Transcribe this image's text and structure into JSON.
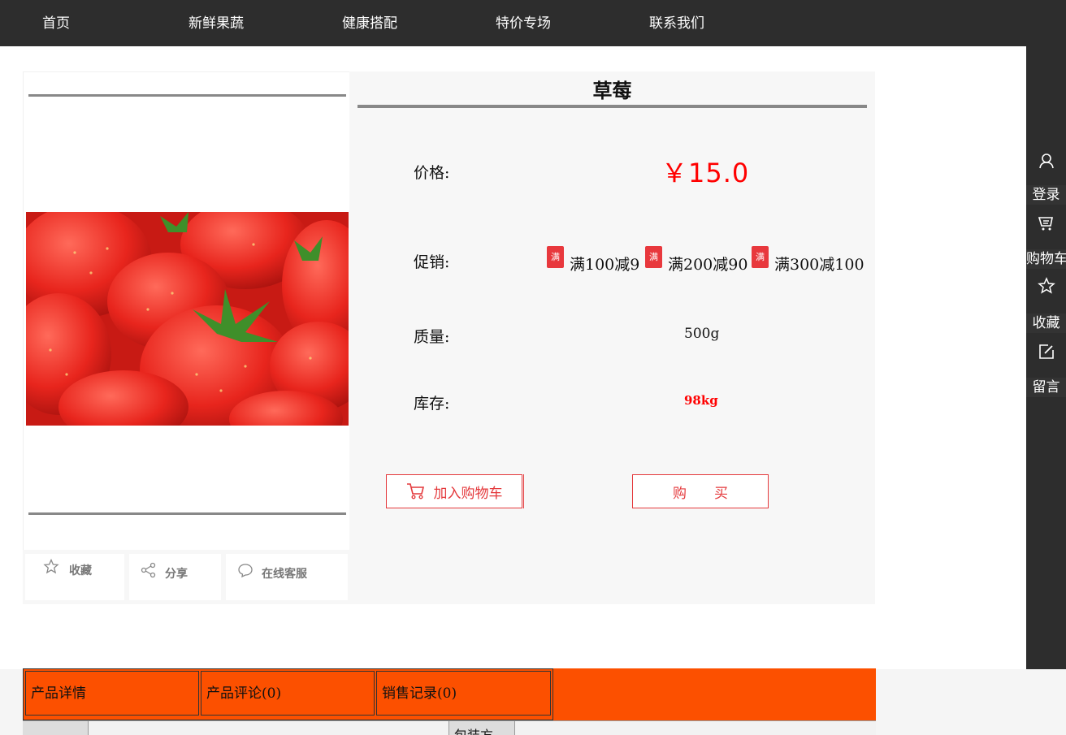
{
  "nav": {
    "items": [
      "首页",
      "新鲜果蔬",
      "健康搭配",
      "特价专场",
      "联系我们"
    ]
  },
  "sidebar": {
    "items": [
      {
        "icon": "user-icon",
        "label": "登录"
      },
      {
        "icon": "cart-icon",
        "label": "购物车"
      },
      {
        "icon": "star-icon",
        "label": "收藏"
      },
      {
        "icon": "edit-icon",
        "label": "留言"
      }
    ]
  },
  "product": {
    "name": "草莓",
    "price_label": "价格:",
    "price": "￥15.0",
    "promo_label": "促销:",
    "promo_tag": "满",
    "promos": [
      "满100减9",
      "满200减90",
      "满300减100"
    ],
    "weight_label": "质量:",
    "weight": "500g",
    "stock_label": "库存:",
    "stock": "98kg",
    "image_icon": "strawberry-photo"
  },
  "actions": {
    "favorite": "收藏",
    "share": "分享",
    "service": "在线客服"
  },
  "buttons": {
    "add_cart": "加入购物车",
    "buy": "购　　买"
  },
  "tabs": [
    "产品详情",
    "产品评论(0)",
    "销售记录(0)"
  ],
  "table": {
    "partial_header": "包装方"
  },
  "colors": {
    "accent": "#fc5000",
    "price": "#ff0000",
    "button": "#e4393c",
    "nav_bg": "#2d2d2d"
  }
}
